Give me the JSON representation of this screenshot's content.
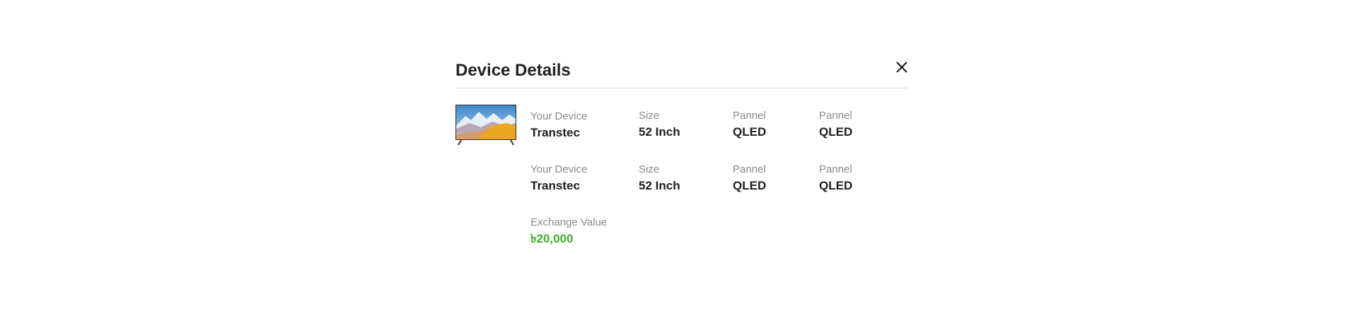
{
  "modal": {
    "title": "Device Details"
  },
  "rows": [
    {
      "device_label": "Your Device",
      "device_value": "Transtec",
      "size_label": "Size",
      "size_value": "52 Inch",
      "panel1_label": "Pannel",
      "panel1_value": "QLED",
      "panel2_label": "Pannel",
      "panel2_value": "QLED"
    },
    {
      "device_label": "Your Device",
      "device_value": "Transtec",
      "size_label": "Size",
      "size_value": "52 Inch",
      "panel1_label": "Pannel",
      "panel1_value": "QLED",
      "panel2_label": "Pannel",
      "panel2_value": "QLED"
    }
  ],
  "exchange": {
    "label": "Exchange Value",
    "value": "৳20,000"
  },
  "colors": {
    "accent_green": "#3dae2b",
    "label_gray": "#8a8a8a",
    "divider": "#d9d9d9"
  },
  "icons": {
    "close": "close-icon",
    "device_image": "tv-thumbnail"
  }
}
